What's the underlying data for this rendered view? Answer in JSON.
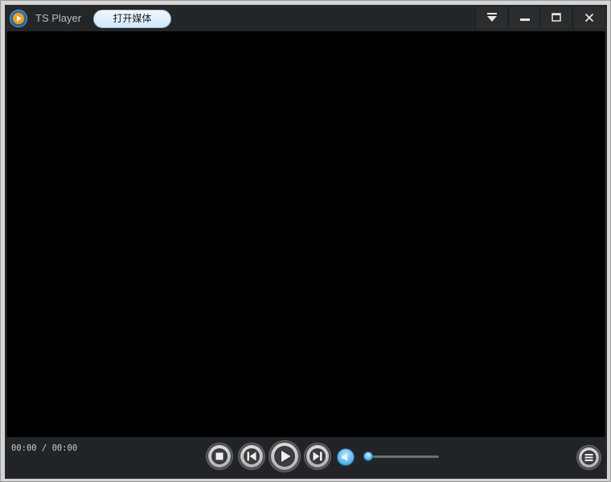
{
  "titlebar": {
    "app_name": "TS Player",
    "open_media_label": "打开媒体",
    "logo_icon": "play-logo-icon",
    "buttons": [
      "menu-dropdown-icon",
      "minimize-icon",
      "maximize-icon",
      "close-icon"
    ]
  },
  "playback": {
    "time_display": "00:00 / 00:00",
    "volume_level": 0.0,
    "icons": [
      "stop-icon",
      "previous-icon",
      "play-icon",
      "next-icon",
      "volume-icon",
      "playlist-icon"
    ]
  },
  "colors": {
    "accent": "#5fb8ef",
    "titlebar_bg": "#252628",
    "video_bg": "#000000",
    "controlbar_bg": "#232427"
  }
}
